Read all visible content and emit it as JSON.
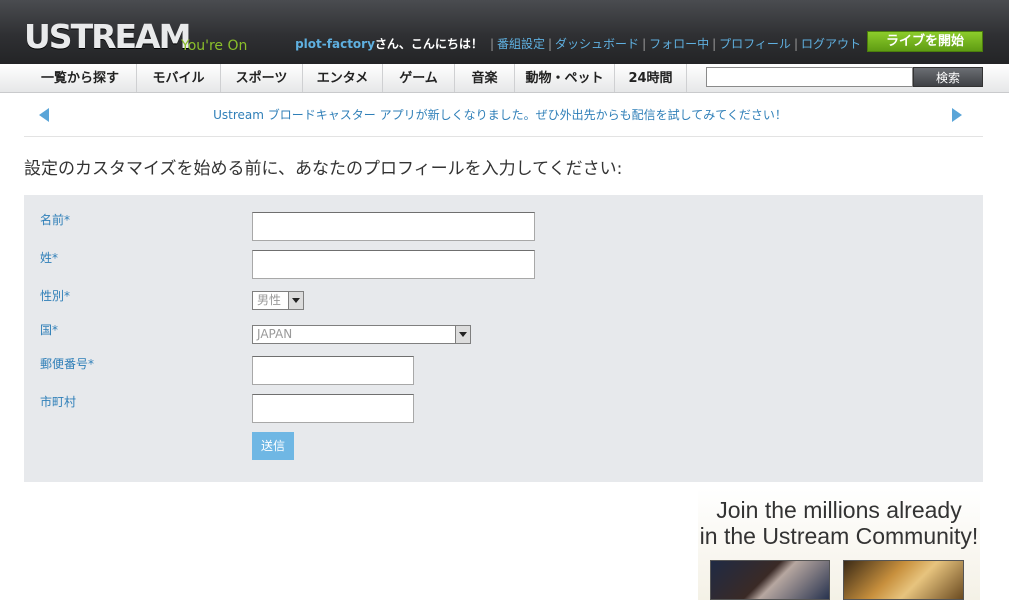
{
  "header": {
    "logo_text": "USTREAM",
    "tagline": "You're On",
    "username": "plot-factory",
    "greeting": "さん、こんにちは！",
    "separator": "|",
    "links": [
      "番組設定",
      "ダッシュボード",
      "フォロー中",
      "プロフィール",
      "ログアウト"
    ],
    "live_button": "ライブを開始"
  },
  "nav": {
    "items": [
      "一覧から探す",
      "モバイル",
      "スポーツ",
      "エンタメ",
      "ゲーム",
      "音楽",
      "動物・ペット",
      "24時間"
    ],
    "search_value": "",
    "search_button": "検索"
  },
  "announcement": {
    "text": "Ustream ブロードキャスター アプリが新しくなりました。ぜひ外出先からも配信を試してみてください！"
  },
  "page": {
    "title": "設定のカスタマイズを始める前に、あなたのプロフィールを入力してください:"
  },
  "form": {
    "first_name_label": "名前*",
    "first_name_value": "",
    "last_name_label": "姓*",
    "last_name_value": "",
    "gender_label": "性別*",
    "gender_value": "男性",
    "country_label": "国*",
    "country_value": "JAPAN",
    "postal_label": "郵便番号*",
    "postal_value": "",
    "city_label": "市町村",
    "city_value": "",
    "submit_label": "送信"
  },
  "promo": {
    "line1": "Join the millions already",
    "line2": "in the Ustream Community!"
  },
  "colors": {
    "accent_blue": "#2f7fb8",
    "live_green": "#7cbf23",
    "panel_bg": "#e7e9ec",
    "header_dark": "#2f3033"
  }
}
